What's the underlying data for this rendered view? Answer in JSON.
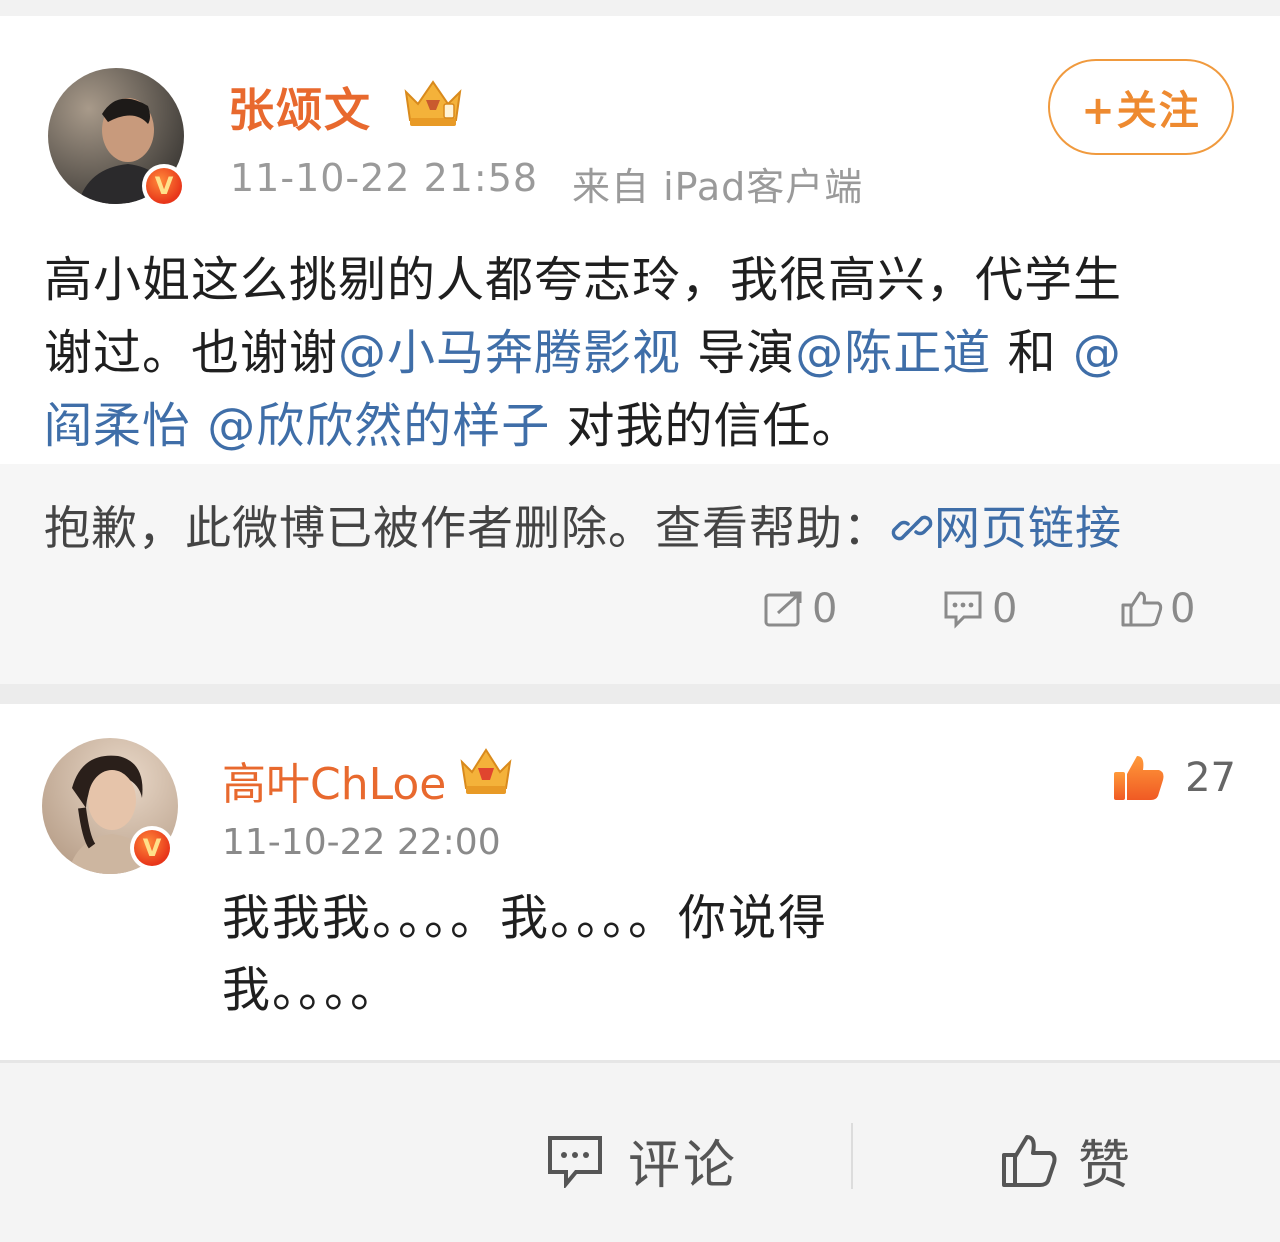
{
  "post": {
    "author": "张颂文",
    "time": "11-10-22 21:58",
    "source": "来自 iPad客户端",
    "follow_label": "+关注",
    "text_line1": "高小姐这么挑剔的人都夸志玲，我很高兴，代学生",
    "text_line2_a": "谢过。也谢谢",
    "mention_1": "@小马奔腾影视",
    "text_line2_b": " 导演",
    "mention_2": "@陈正道",
    "text_line2_c": " 和 ",
    "mention_3": "@阎柔怡",
    "text_line3_a": " ",
    "mention_4": "@欣欣然的样子",
    "text_line3_b": " 对我的信任。"
  },
  "deleted_repost": {
    "message": "抱歉，此微博已被作者删除。查看帮助：",
    "link_label": "网页链接",
    "repost_count": "0",
    "comment_count": "0",
    "like_count": "0"
  },
  "comment": {
    "author": "高叶ChLoe",
    "time": "11-10-22 22:00",
    "text_line1": "我我我。。。。我。。。。你说得",
    "text_line2": "我。。。。",
    "like_count": "27"
  },
  "bottom_bar": {
    "comment_label": "评论",
    "like_label": "赞"
  },
  "colors": {
    "username": "#e8692e",
    "mention": "#3f6ea8",
    "follow": "#ee8a30",
    "deleted_bg": "#f6f6f6"
  },
  "icons": [
    "verified-badge-icon",
    "crown-icon",
    "repost-icon",
    "comment-icon",
    "thumbs-up-icon",
    "link-icon"
  ]
}
